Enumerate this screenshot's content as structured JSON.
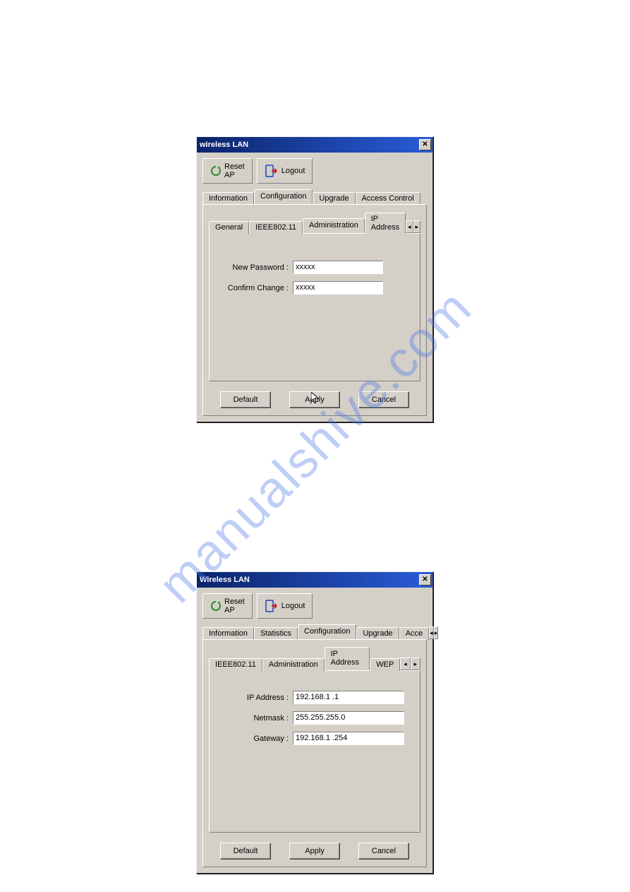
{
  "watermark": "manualshive.com",
  "window1": {
    "title": "wireless LAN",
    "toolbar": {
      "reset_line1": "Reset",
      "reset_line2": "AP",
      "logout": "Logout"
    },
    "tabs_main": [
      "Information",
      "Configuration",
      "Upgrade",
      "Access Control"
    ],
    "tabs_main_active": 1,
    "tabs_sub": [
      "General",
      "IEEE802.11",
      "Administration",
      "IP Address"
    ],
    "tabs_sub_active": 2,
    "form": {
      "new_password_label": "New Password :",
      "new_password_value": "xxxxx",
      "confirm_change_label": "Confirm Change :",
      "confirm_change_value": "xxxxx"
    },
    "buttons": {
      "default": "Default",
      "apply": "Apply",
      "cancel": "Cancel"
    }
  },
  "window2": {
    "title": "Wireless LAN",
    "toolbar": {
      "reset_line1": "Reset",
      "reset_line2": "AP",
      "logout": "Logout"
    },
    "tabs_main": [
      "Information",
      "Statistics",
      "Configuration",
      "Upgrade",
      "Acce"
    ],
    "tabs_main_active": 2,
    "tabs_sub": [
      "IEEE802.11",
      "Administration",
      "IP Address",
      "WEP"
    ],
    "tabs_sub_active": 2,
    "form": {
      "ip_label": "IP Address :",
      "ip_value": "192.168.1 .1",
      "netmask_label": "Netmask :",
      "netmask_value": "255.255.255.0",
      "gateway_label": "Gateway :",
      "gateway_value": "192.168.1 .254"
    },
    "buttons": {
      "default": "Default",
      "apply": "Apply",
      "cancel": "Cancel"
    }
  }
}
